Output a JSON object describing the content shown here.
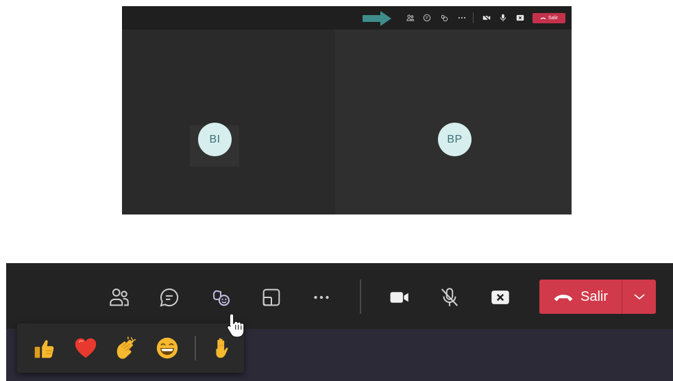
{
  "mini_window": {
    "participants": [
      {
        "initials": "BI"
      },
      {
        "initials": "BP"
      }
    ],
    "toolbar": {
      "leave_label": "Salir"
    }
  },
  "toolbar": {
    "items": [
      {
        "icon": "people-icon"
      },
      {
        "icon": "chat-icon"
      },
      {
        "icon": "reactions-icon"
      },
      {
        "icon": "share-screen-icon"
      },
      {
        "icon": "more-options-icon"
      },
      {
        "icon": "camera-icon"
      },
      {
        "icon": "microphone-muted-icon"
      },
      {
        "icon": "share-tray-icon"
      }
    ],
    "leave_label": "Salir"
  },
  "reactions_popup": {
    "items": [
      {
        "icon": "like-icon"
      },
      {
        "icon": "heart-icon"
      },
      {
        "icon": "applause-icon"
      },
      {
        "icon": "laugh-icon"
      },
      {
        "icon": "raise-hand-icon"
      }
    ]
  },
  "colors": {
    "leave_red": "#d13a4a",
    "avatar_bg": "#d6eeee",
    "avatar_text": "#3f6f74",
    "arrow_teal": "#3e8d8a",
    "toolbar_bg": "#232323",
    "emoji_yellow": "#f5b82e",
    "heart_red": "#e8392f"
  }
}
